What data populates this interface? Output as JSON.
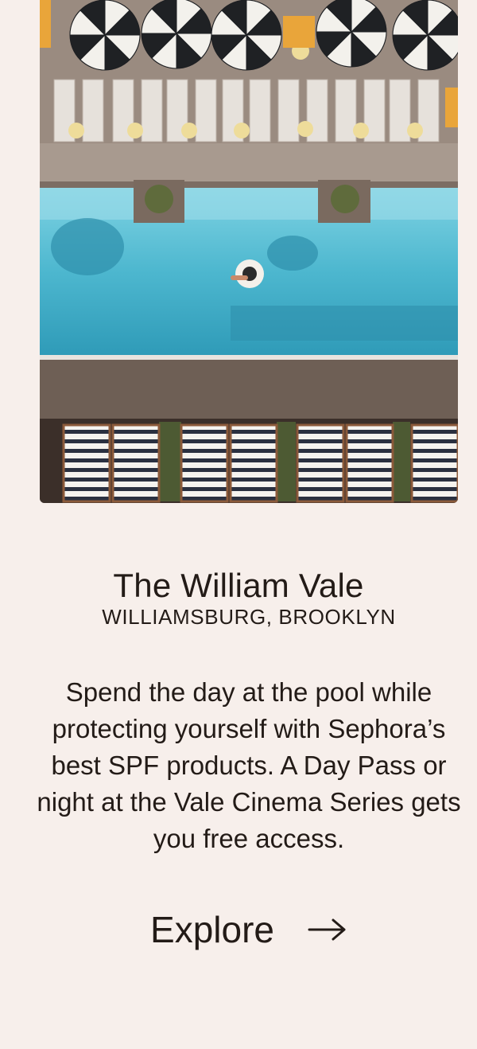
{
  "card": {
    "image": {
      "alt": "Aerial view of the rooftop pool with striped umbrellas and cabanas"
    },
    "title": "The William Vale",
    "location": "WILLIAMSBURG, BROOKLYN",
    "description": "Spend the day at the pool while protecting yourself with Sephora’s best SPF products. A Day Pass or night at the Vale Cinema Series gets you free access.",
    "cta": {
      "label": "Explore",
      "icon": "arrow-right-icon"
    }
  },
  "colors": {
    "background": "#f7efeb",
    "text": "#231b17",
    "pool": "#4fb9cf",
    "deck": "#8c7d72"
  }
}
